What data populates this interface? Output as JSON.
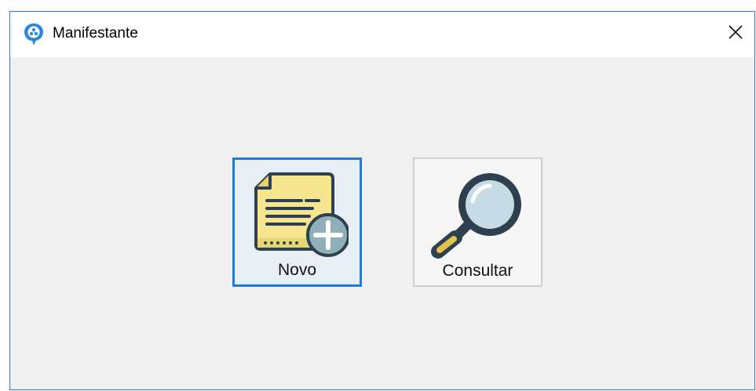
{
  "window": {
    "title": "Manifestante"
  },
  "titlebar": {
    "app_icon": "chat-bubble-icon",
    "close_icon": "close-icon",
    "close_glyph": "✕"
  },
  "actions": [
    {
      "label": "Novo",
      "icon": "new-document-icon",
      "selected": true
    },
    {
      "label": "Consultar",
      "icon": "magnifier-icon",
      "selected": false
    }
  ],
  "colors": {
    "accent": "#1e7bd6",
    "window_border": "#2b79d8",
    "background": "#f0f0f0"
  }
}
